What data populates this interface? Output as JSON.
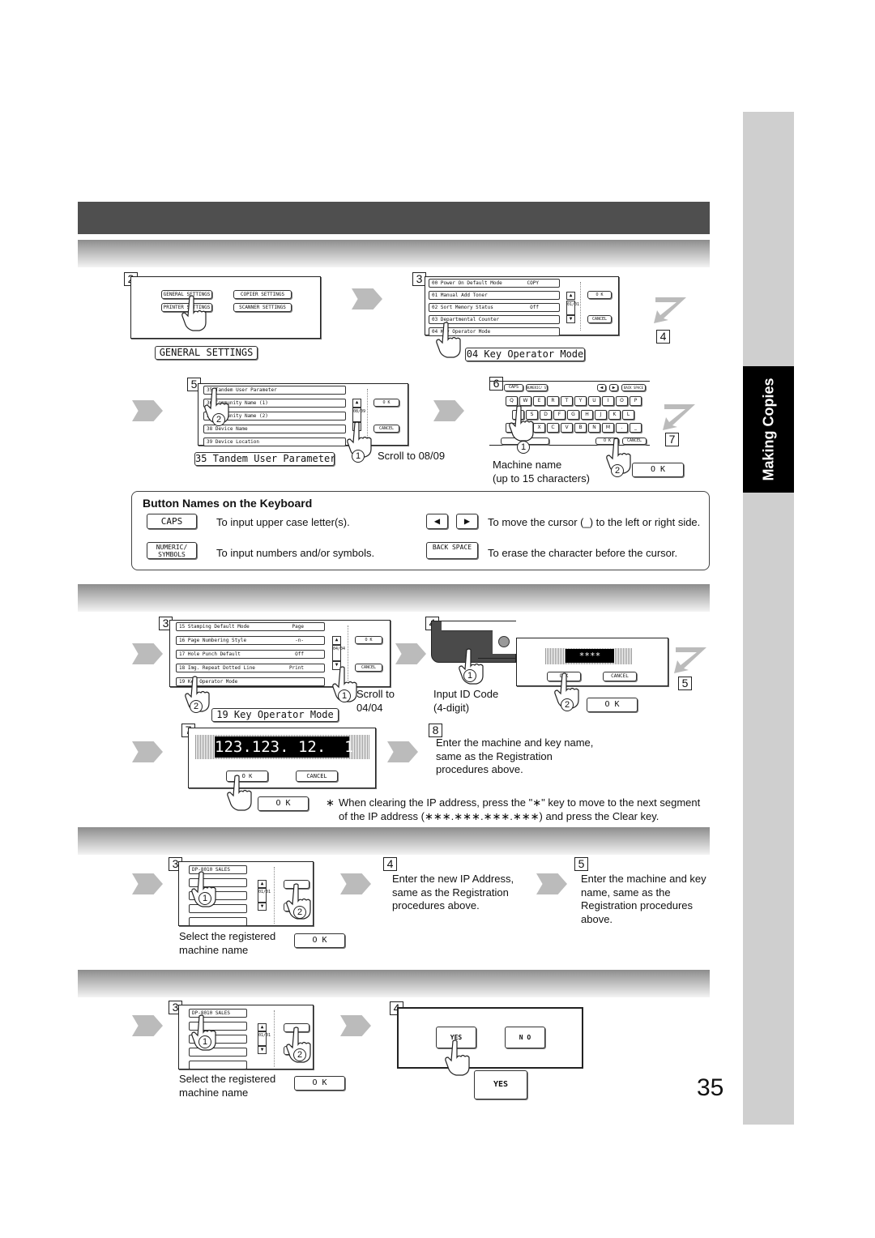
{
  "side_tab": {
    "label": "Making Copies"
  },
  "page_number": "35",
  "registration": {
    "step2": {
      "num": "2",
      "buttons": [
        "GENERAL SETTINGS",
        "COPIER SETTINGS",
        "PRINTER SETTINGS",
        "SCANNER SETTINGS"
      ],
      "callout": "GENERAL SETTINGS"
    },
    "step3": {
      "num": "3",
      "rows": [
        {
          "label": "00  Power On Default Mode",
          "value": "COPY"
        },
        {
          "label": "01  Manual Add Toner",
          "value": ""
        },
        {
          "label": "02  Sort Memory Status",
          "value": "Off"
        },
        {
          "label": "03  Departmental Counter",
          "value": ""
        },
        {
          "label": "04  Key Operator Mode",
          "value": ""
        }
      ],
      "page": "01/01",
      "ok": "O K",
      "cancel": "CANCEL",
      "callout": "04  Key Operator Mode"
    },
    "step4_marker": "4",
    "step5": {
      "num": "5",
      "rows": [
        {
          "label": "35  Tandem User Parameter",
          "value": ""
        },
        {
          "label": "36  Community Name (1)",
          "value": ""
        },
        {
          "label": "37  Community Name (2)",
          "value": ""
        },
        {
          "label": "38  Device Name",
          "value": ""
        },
        {
          "label": "39  Device Location",
          "value": ""
        }
      ],
      "page": "08/09",
      "ok": "O K",
      "cancel": "CANCEL",
      "callout": "35  Tandem User Parameter",
      "scroll_note": "Scroll to 08/09",
      "hand1": "1",
      "hand2": "2"
    },
    "step6": {
      "num": "6",
      "top_keys": [
        "CAPS",
        "NUMERIC/ SYMBOLS",
        "◀",
        "▶",
        "BACK SPACE"
      ],
      "row1": [
        "Q",
        "W",
        "E",
        "R",
        "T",
        "Y",
        "U",
        "I",
        "O",
        "P"
      ],
      "row2": [
        "A",
        "S",
        "D",
        "F",
        "G",
        "H",
        "J",
        "K",
        "L"
      ],
      "row3": [
        "@",
        "Z",
        "X",
        "C",
        "V",
        "B",
        "N",
        "M",
        ".",
        "_"
      ],
      "ok": "O K",
      "cancel": "CANCEL",
      "note_line1": "Machine name",
      "note_line2": "(up to 15 characters)",
      "callout_ok": "O K",
      "hand1": "1",
      "hand2": "2"
    },
    "step7_marker": "7"
  },
  "keyboard_legend": {
    "title": "Button Names on the Keyboard",
    "items": [
      {
        "key": "CAPS",
        "desc": "To input upper case letter(s)."
      },
      {
        "key": "NUMERIC/ SYMBOLS",
        "desc": "To input numbers and/or symbols."
      },
      {
        "key": "◀ ▶",
        "desc": "To move the cursor (_) to the left or right side."
      },
      {
        "key": "BACK SPACE",
        "desc": "To erase the character before the cursor."
      }
    ]
  },
  "edit": {
    "step3": {
      "num": "3",
      "rows": [
        {
          "label": "15  Stamping Default Mode",
          "value": "Page"
        },
        {
          "label": "16  Page Numbering Style",
          "value": "-n-"
        },
        {
          "label": "17  Hole Punch Default",
          "value": "Off"
        },
        {
          "label": "18  Img. Repeat Dotted Line",
          "value": "Print"
        },
        {
          "label": "19  Key Operator Mode",
          "value": ""
        }
      ],
      "page": "04/04",
      "ok": "O K",
      "cancel": "CANCEL",
      "callout": "19  Key Operator Mode",
      "scroll_note_1": "Scroll to",
      "scroll_note_2": "04/04",
      "hand1": "1",
      "hand2": "2"
    },
    "step4": {
      "num": "4",
      "display": "****",
      "ok": "O K",
      "cancel": "CANCEL",
      "note_line1": "Input ID Code",
      "note_line2": "(4-digit)",
      "callout_ok": "O K",
      "hand1": "1",
      "hand2": "2"
    },
    "step5_marker": "5",
    "step7": {
      "num": "7",
      "ip": "123.123. 12.  1",
      "ok": "O K",
      "cancel": "CANCEL",
      "callout_ok": "O K"
    },
    "step8": {
      "num": "8",
      "text": "Enter the machine and key name, same as the Registration procedures above."
    },
    "note": {
      "mark": "∗",
      "line1": "When clearing the IP address, press the \"∗\" key to move to the next segment",
      "line2": "of the IP address (∗∗∗.∗∗∗.∗∗∗.∗∗∗) and press the Clear key."
    }
  },
  "change": {
    "step3": {
      "num": "3",
      "first_row": "DP-8010 SALES",
      "page": "01/01",
      "note_line1": "Select the registered",
      "note_line2": "machine name",
      "callout_ok": "O K",
      "hand1": "1",
      "hand2": "2"
    },
    "step4": {
      "num": "4",
      "text": "Enter the new IP Address, same as the Registration procedures above."
    },
    "step5": {
      "num": "5",
      "text": "Enter the machine and key name, same as the Registration procedures above."
    }
  },
  "delete": {
    "step3": {
      "num": "3",
      "first_row": "DP-8010 SALES",
      "page": "01/01",
      "note_line1": "Select the registered",
      "note_line2": "machine name",
      "callout_ok": "O K",
      "hand1": "1",
      "hand2": "2"
    },
    "step4": {
      "num": "4",
      "yes": "YES",
      "no": "N O",
      "callout_yes": "YES"
    }
  }
}
